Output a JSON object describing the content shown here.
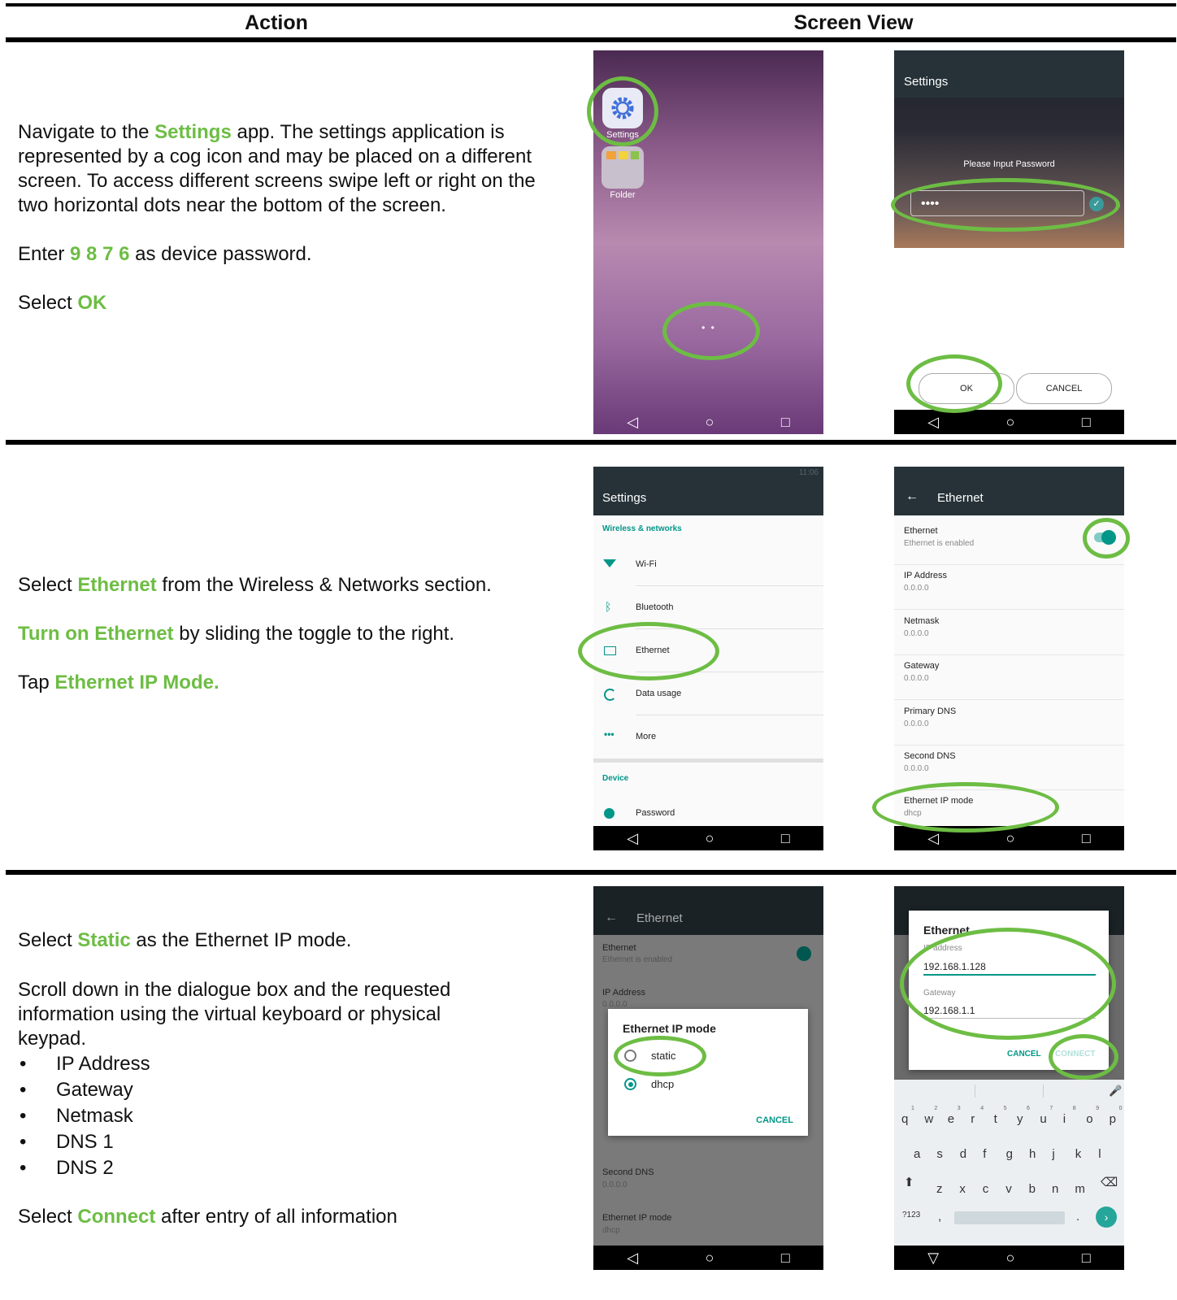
{
  "header": {
    "action": "Action",
    "screen_view": "Screen View"
  },
  "row1": {
    "line1_pre": "Navigate to the ",
    "line1_hl": "Settings",
    "line1_post": " app. The settings application is represented by a cog icon and may be placed on a different screen. To access different screens swipe left or right on the two horizontal dots near the bottom of the screen.",
    "line2_pre": "Enter ",
    "line2_hl": "9 8 7 6",
    "line2_post": " as device password.",
    "line3_pre": "Select ",
    "line3_hl": "OK",
    "phone_a": {
      "icon1_label": "Settings",
      "icon2_label": "Folder",
      "dots": "• •"
    },
    "phone_b": {
      "title": "Settings",
      "prompt": "Please Input Password",
      "password": "••••",
      "ok": "OK",
      "cancel": "CANCEL"
    }
  },
  "row2": {
    "line1_pre": "Select ",
    "line1_hl": "Ethernet",
    "line1_post": " from the Wireless & Networks section.",
    "line2_hl": "Turn on Ethernet",
    "line2_post": " by sliding the toggle to the right.",
    "line3_pre": "Tap ",
    "line3_hl": "Ethernet IP Mode.",
    "phone_a": {
      "status": "11:06",
      "title": "Settings",
      "section1": "Wireless & networks",
      "items": [
        "Wi-Fi",
        "Bluetooth",
        "Ethernet",
        "Data usage",
        "More"
      ],
      "section2": "Device",
      "item_device": "Password"
    },
    "phone_b": {
      "title": "Ethernet",
      "back": "←",
      "rows": [
        {
          "title": "Ethernet",
          "sub": "Ethernet is enabled"
        },
        {
          "title": "IP Address",
          "sub": "0.0.0.0"
        },
        {
          "title": "Netmask",
          "sub": "0.0.0.0"
        },
        {
          "title": "Gateway",
          "sub": "0.0.0.0"
        },
        {
          "title": "Primary DNS",
          "sub": "0.0.0.0"
        },
        {
          "title": "Second DNS",
          "sub": "0.0.0.0"
        },
        {
          "title": "Ethernet IP mode",
          "sub": "dhcp"
        }
      ]
    }
  },
  "row3": {
    "line1_pre": "Select ",
    "line1_hl": "Static",
    "line1_post": " as the Ethernet IP mode.",
    "line2": "Scroll down in the dialogue box and the requested information using the virtual keyboard or physical keypad.",
    "bullets": [
      "IP Address",
      "Gateway",
      "Netmask",
      "DNS 1",
      "DNS 2"
    ],
    "line3_pre": "Select ",
    "line3_hl": "Connect",
    "line3_post": " after entry of all information",
    "phone_a": {
      "title": "Ethernet",
      "rows": [
        {
          "title": "Ethernet",
          "sub": "Ethernet is enabled"
        },
        {
          "title": "IP Address",
          "sub": "0.0.0.0"
        },
        {
          "title": "Second DNS",
          "sub": "0.0.0.0"
        },
        {
          "title": "Ethernet IP mode",
          "sub": "dhcp"
        }
      ],
      "dialog_title": "Ethernet IP mode",
      "opt1": "static",
      "opt2": "dhcp",
      "cancel": "CANCEL"
    },
    "phone_b": {
      "dialog_title": "Ethernet",
      "field1_label": "IP address",
      "field1_value": "192.168.1.128",
      "field2_label": "Gateway",
      "field2_value": "192.168.1.1",
      "cancel": "CANCEL",
      "connect": "CONNECT",
      "kb_row1": [
        "q",
        "w",
        "e",
        "r",
        "t",
        "y",
        "u",
        "i",
        "o",
        "p"
      ],
      "kb_row1_nums": [
        "1",
        "2",
        "3",
        "4",
        "5",
        "6",
        "7",
        "8",
        "9",
        "0"
      ],
      "kb_row2": [
        "a",
        "s",
        "d",
        "f",
        "g",
        "h",
        "j",
        "k",
        "l"
      ],
      "kb_row3": [
        "z",
        "x",
        "c",
        "v",
        "b",
        "n",
        "m"
      ],
      "kb_sym": "?123",
      "kb_comma": ",",
      "kb_period": "."
    }
  },
  "nav": {
    "back": "◁",
    "home": "○",
    "recent": "□",
    "back_down": "▽"
  },
  "colors": {
    "highlight": "#6dbd44",
    "teal": "#009688",
    "toolbar": "#263238"
  }
}
